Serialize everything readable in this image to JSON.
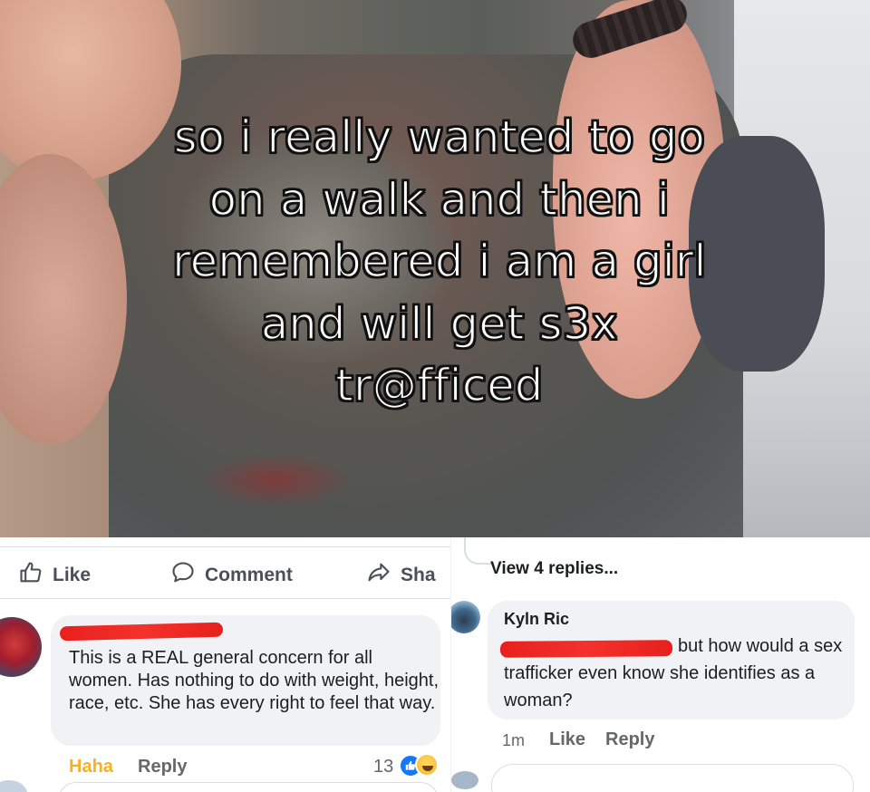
{
  "meme": {
    "caption_lines": [
      "so i really wanted to go",
      "on a walk and then i",
      "remembered i am a girl",
      "and will get s3x",
      "tr@fficed"
    ]
  },
  "left_post": {
    "actions": {
      "like_label": "Like",
      "comment_label": "Comment",
      "share_label": "Sha"
    },
    "comment": {
      "text": "This is a REAL general concern for all women.  Has nothing to do with weight, height, race, etc. She has every right to feel that way.",
      "reaction_label": "Haha",
      "reply_label": "Reply",
      "reaction_count": "13"
    }
  },
  "right_post": {
    "view_replies": "View 4 replies...",
    "comment": {
      "author": "Kyln Ric",
      "text": "but how would a sex trafficker even know she identifies as a woman?",
      "time": "1m",
      "like_label": "Like",
      "reply_label": "Reply"
    }
  },
  "colors": {
    "link_gray": "#65676b",
    "bubble_bg": "#f0f2f5",
    "haha_color": "#f7b125",
    "like_blue": "#1877f2",
    "redaction_red": "#f4312c"
  }
}
